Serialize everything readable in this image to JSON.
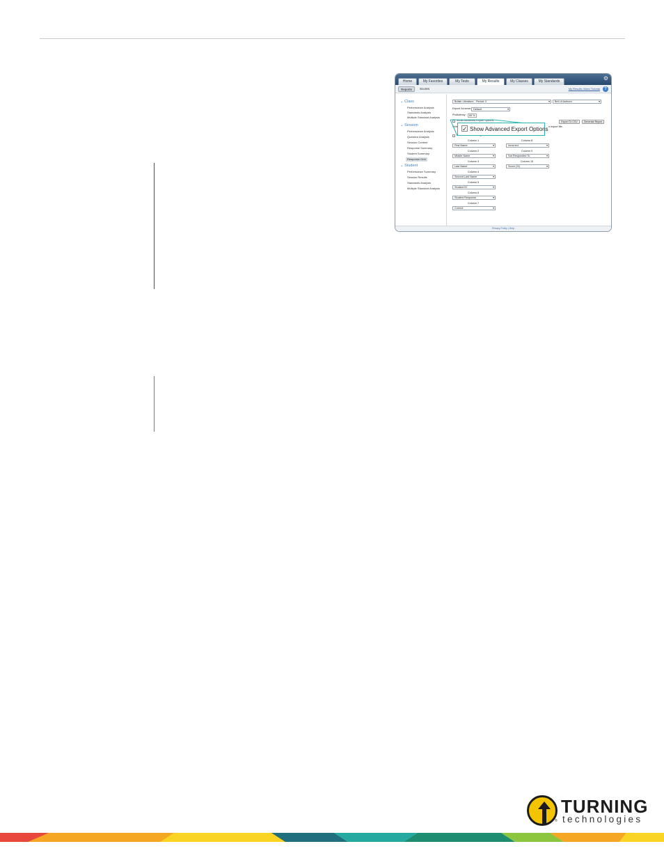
{
  "nav": {
    "tabs": [
      "Home",
      "My Favorites",
      "My Tests",
      "My Results",
      "My Classes",
      "My Standards"
    ],
    "active": "My Results"
  },
  "subnav": {
    "tabs": [
      "Reports",
      "Scores"
    ],
    "tutorial_link": "My Results Video Tutorial",
    "help": "?"
  },
  "sidebar": {
    "class_title": "Class",
    "class_items": [
      "Performance Analysis",
      "Standards Analysis",
      "Multiple Standard Analysis"
    ],
    "session_title": "Session",
    "session_items": [
      "Performance Analysis",
      "Question Analysis",
      "Session Content",
      "Response Summary",
      "Student Summary",
      "Response Grid"
    ],
    "student_title": "Student",
    "student_items": [
      "Performance Summary",
      "Session Results",
      "Standards Analysis",
      "Multiple Standard Analysis"
    ],
    "selected": "Response Grid"
  },
  "main": {
    "class_select": "British Literature - Period: 2",
    "test_select": "Brit Lit Authors",
    "export_scheme_label": "Export Scheme:",
    "export_scheme_value": "Default",
    "proficiency_label": "Proficiency:",
    "proficiency_value": "69 %",
    "show_advanced_label": "Show Advanced Export Options",
    "export_csv_button": "Export To CSV",
    "generate_report_button": "Generate Report",
    "peek_left": "Sele",
    "peek_right": "o export file.",
    "include_class_average": "Include Class Average",
    "columns": [
      {
        "label": "Column 1",
        "value": "First Name"
      },
      {
        "label": "Column 2",
        "value": "Middle Name"
      },
      {
        "label": "Column 3",
        "value": "Last Name"
      },
      {
        "label": "Column 4",
        "value": "Second Last Name"
      },
      {
        "label": "Column 5",
        "value": "Student ID"
      },
      {
        "label": "Column 6",
        "value": "Student Response"
      },
      {
        "label": "Column 7",
        "value": "Correct"
      },
      {
        "label": "Column 8",
        "value": "Incorrect"
      },
      {
        "label": "Column 9",
        "value": "Not Responded To"
      },
      {
        "label": "Column 10",
        "value": "Score (%)"
      }
    ],
    "footer": "Privacy Policy  |  Help"
  },
  "callout": {
    "text": "Show Advanced Export Options",
    "check": "✓"
  },
  "logo": {
    "word": "TURNING",
    "sub": "technologies",
    "registered": "®"
  },
  "colors": {
    "purple_bar": "#7a2f6e",
    "teal_bar": "#20a5a5",
    "callout": "#29b3b3",
    "logo_yellow": "#f4c400"
  }
}
